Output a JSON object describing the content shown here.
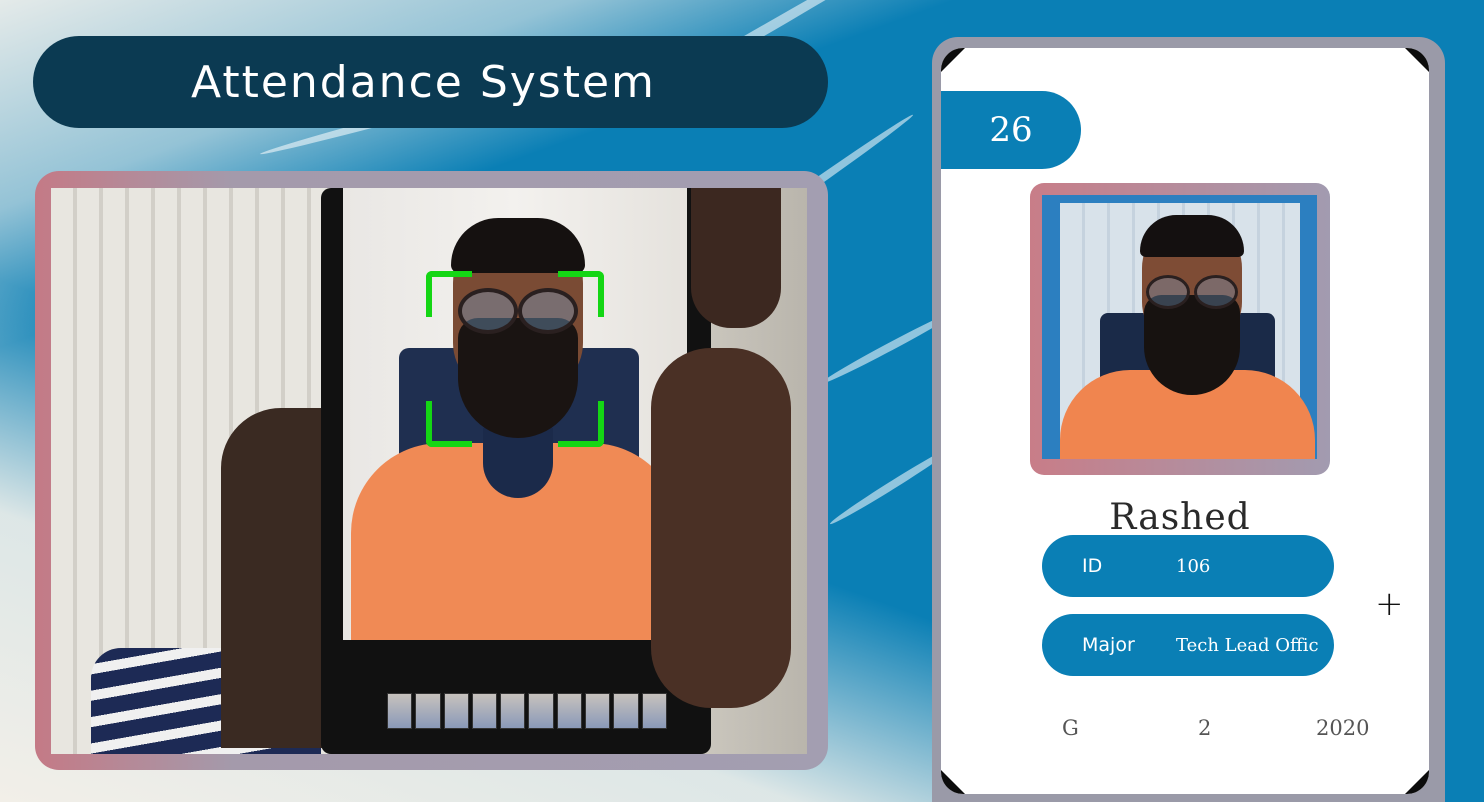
{
  "header": {
    "title": "Attendance System"
  },
  "camera": {
    "detection_color": "#14d614"
  },
  "student": {
    "attendance_count": "26",
    "name": "Rashed",
    "id_label": "ID",
    "id_value": "106",
    "major_label": "Major",
    "major_value": "Tech Lead Offic",
    "add_symbol": "+",
    "standing": "G",
    "year": "2",
    "starting_year": "2020"
  },
  "colors": {
    "accent": "#0a7fb5",
    "title_bar": "#0b3a52"
  }
}
